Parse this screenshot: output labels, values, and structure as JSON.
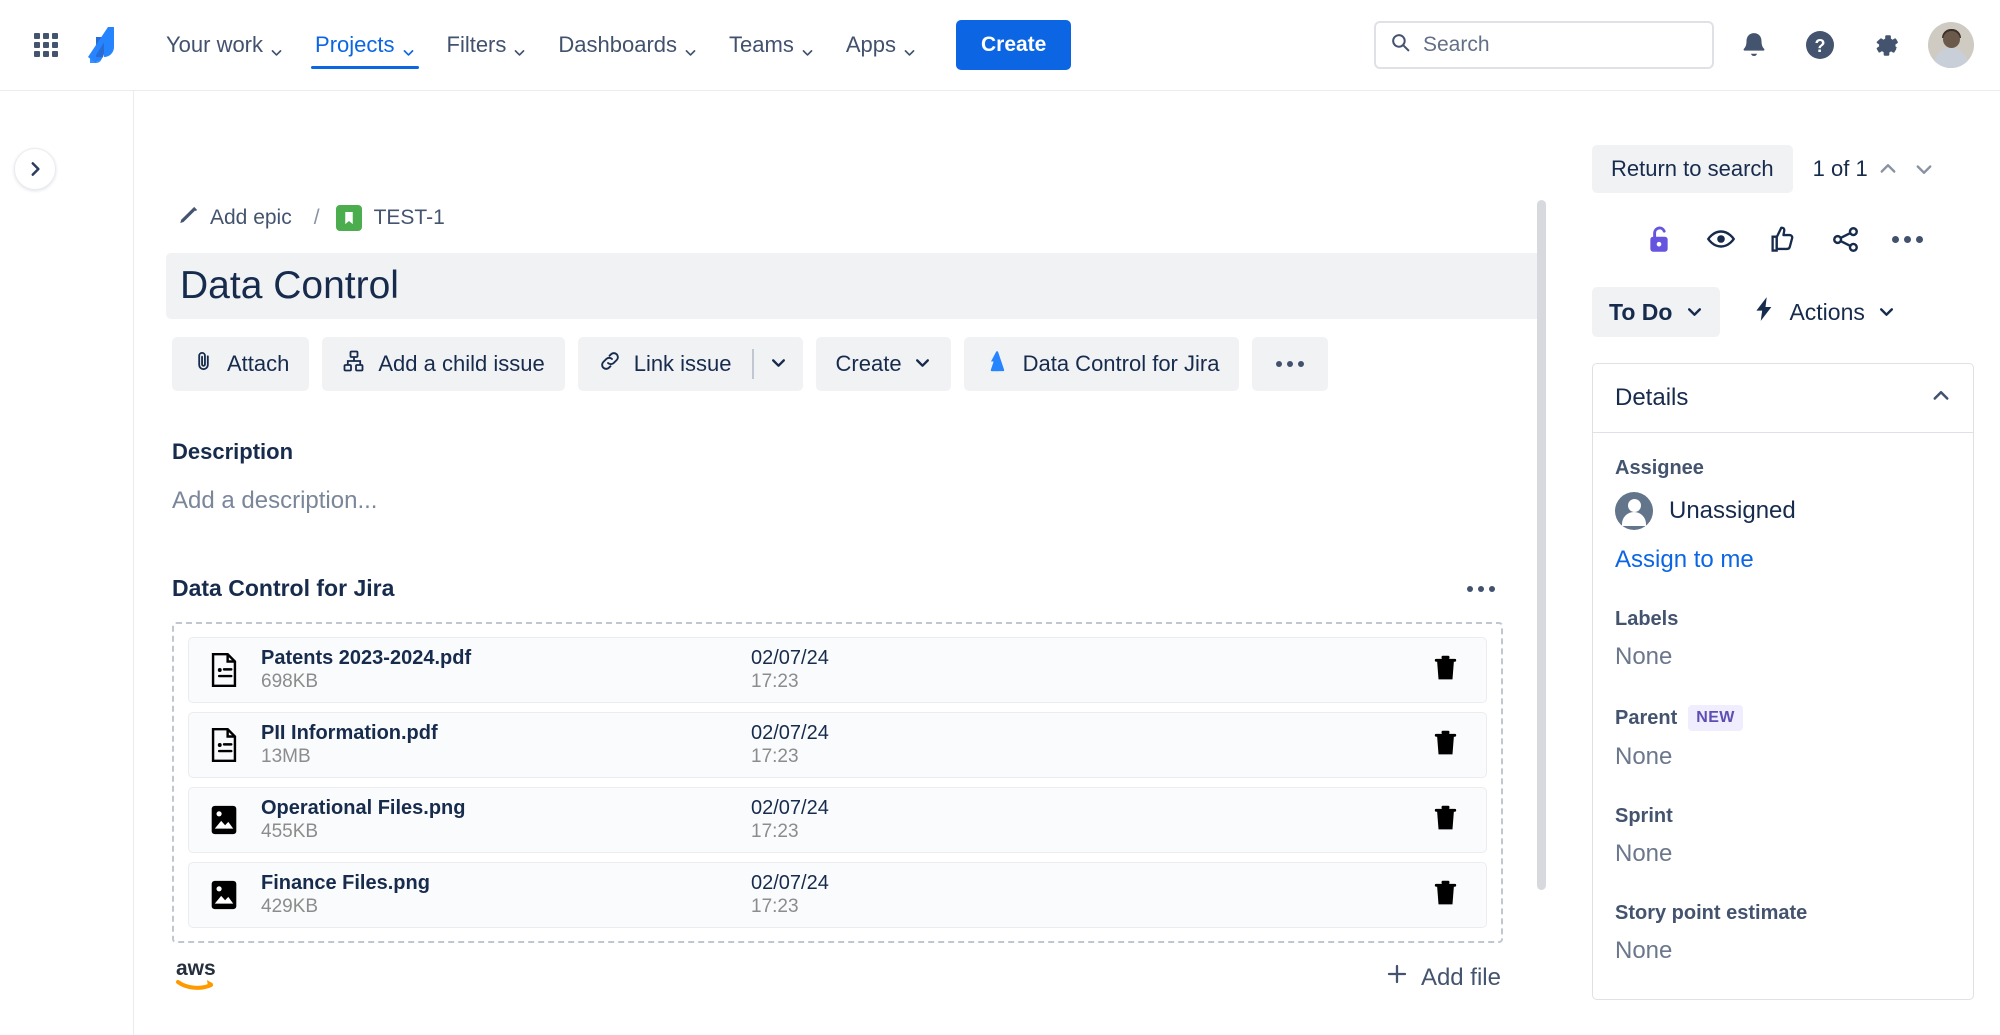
{
  "nav": {
    "apps_icon": "grid-apps-icon",
    "logo": "jira-logo",
    "items": [
      {
        "label": "Your work",
        "active": false
      },
      {
        "label": "Projects",
        "active": true
      },
      {
        "label": "Filters",
        "active": false
      },
      {
        "label": "Dashboards",
        "active": false
      },
      {
        "label": "Teams",
        "active": false
      },
      {
        "label": "Apps",
        "active": false
      }
    ],
    "create_label": "Create",
    "search_placeholder": "Search",
    "search_value": "",
    "icons": [
      "notifications-icon",
      "help-icon",
      "settings-icon",
      "avatar"
    ]
  },
  "breadcrumb": {
    "epic_label": "Add epic",
    "separator": "/",
    "issue_key": "TEST-1"
  },
  "issue": {
    "title": "Data Control",
    "description_label": "Description",
    "description_placeholder": "Add a description..."
  },
  "actions": {
    "attach": "Attach",
    "add_child": "Add a child issue",
    "link_issue": "Link issue",
    "create": "Create",
    "app_button": "Data Control for Jira",
    "more": "..."
  },
  "attachments_panel": {
    "title": "Data Control for Jira",
    "add_file_label": "Add file",
    "aws_logo": "aws-logo",
    "files": [
      {
        "name": "Patents 2023-2024.pdf",
        "size": "698KB",
        "date": "02/07/24",
        "time": "17:23",
        "type": "pdf"
      },
      {
        "name": "PII Information.pdf",
        "size": "13MB",
        "date": "02/07/24",
        "time": "17:23",
        "type": "pdf"
      },
      {
        "name": "Operational Files.png",
        "size": "455KB",
        "date": "02/07/24",
        "time": "17:23",
        "type": "image"
      },
      {
        "name": "Finance Files.png",
        "size": "429KB",
        "date": "02/07/24",
        "time": "17:23",
        "type": "image"
      }
    ]
  },
  "sidebar": {
    "return_label": "Return to search",
    "page_count": "1 of 1",
    "quick_icons": [
      "unlock-icon",
      "eye-watch-icon",
      "thumbs-up-icon",
      "share-icon",
      "more-options-icon"
    ],
    "status_label": "To Do",
    "actions_label": "Actions",
    "details_title": "Details",
    "fields": [
      {
        "label": "Assignee",
        "value": "Unassigned",
        "badge": "",
        "link": "Assign to me"
      },
      {
        "label": "Labels",
        "value": "None",
        "badge": "",
        "link": ""
      },
      {
        "label": "Parent",
        "value": "None",
        "badge": "NEW",
        "link": ""
      },
      {
        "label": "Sprint",
        "value": "None",
        "badge": "",
        "link": ""
      },
      {
        "label": "Story point estimate",
        "value": "None",
        "badge": "",
        "link": ""
      }
    ]
  },
  "colors": {
    "brand_blue": "#0c66e4",
    "text": "#172b4d",
    "subtle": "#6b778c",
    "neutral_bg": "#f1f2f4",
    "green": "#4bad4e",
    "purple": "#5e4db2",
    "aws_orange": "#ff9900"
  }
}
